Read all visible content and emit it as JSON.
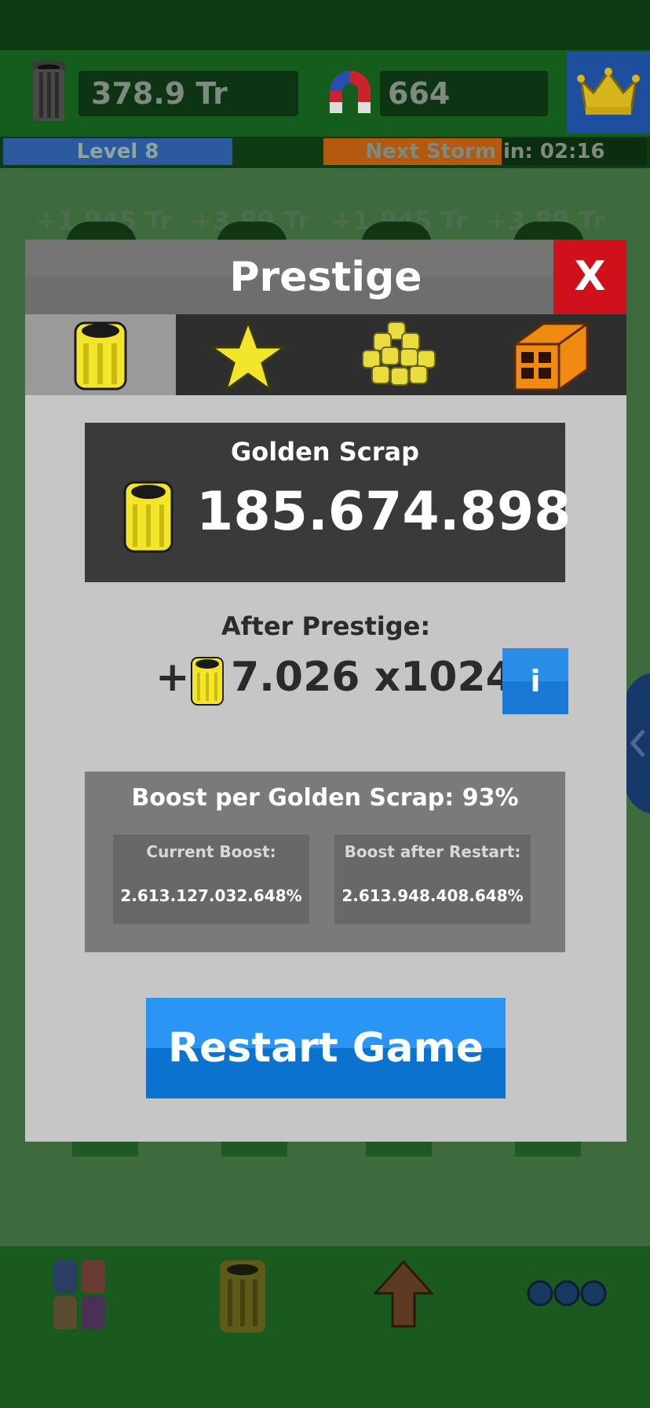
{
  "header": {
    "scrap_value": "378.9 Tr",
    "magnet_value": "664",
    "level_label": "Level 8",
    "storm_label": "Next Storm in: 02:16",
    "storm_progress": 0.55
  },
  "background_gains": [
    "+1.945 Tr",
    "+3.89 Tr",
    "+1.945 Tr",
    "+3.89 Tr"
  ],
  "dialog": {
    "title": "Prestige",
    "close_label": "X",
    "tabs": [
      {
        "icon": "golden-scrap-icon",
        "active": true
      },
      {
        "icon": "star-icon",
        "active": false
      },
      {
        "icon": "scrap-pile-icon",
        "active": false
      },
      {
        "icon": "brick-icon",
        "active": false
      }
    ],
    "golden_scrap": {
      "label": "Golden Scrap",
      "value": "185.674.898"
    },
    "after_prestige": {
      "label": "After Prestige:",
      "plus": "+",
      "value": "7.026 x1024",
      "info_label": "i"
    },
    "boost": {
      "title": "Boost per Golden Scrap: 93%",
      "current_label": "Current Boost:",
      "current_value": "2.613.127.032.648%",
      "after_label": "Boost after Restart:",
      "after_value": "2.613.948.408.648%"
    },
    "restart_label": "Restart Game"
  },
  "bottom_nav": [
    {
      "icon": "barrels-collection-icon"
    },
    {
      "icon": "golden-barrel-icon"
    },
    {
      "icon": "upgrade-arrow-icon"
    },
    {
      "icon": "more-dots-icon"
    }
  ],
  "colors": {
    "dialog_bg": "#c6c6c6",
    "close_red": "#d0101a",
    "accent_blue": "#2b95f5",
    "gold": "#f3e52a"
  }
}
